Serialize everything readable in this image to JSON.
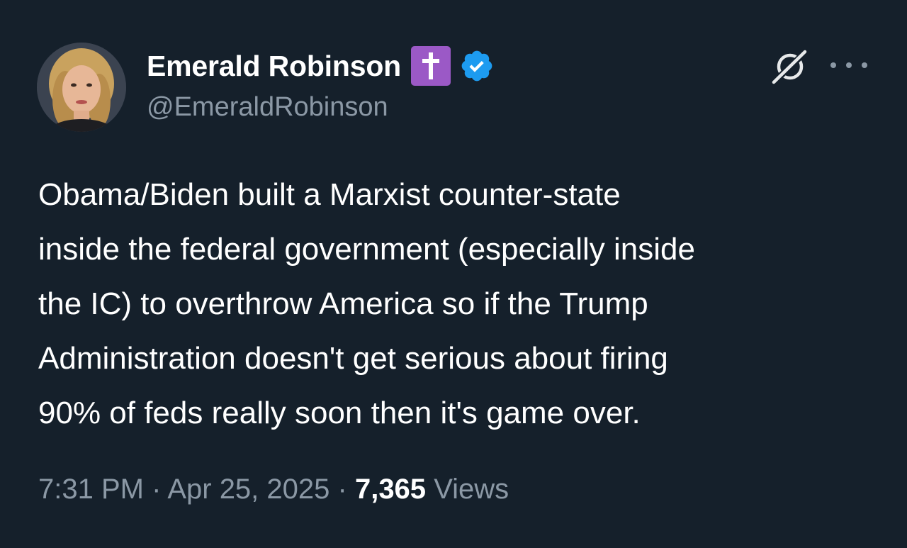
{
  "author": {
    "display_name": "Emerald Robinson",
    "handle": "@EmeraldRobinson",
    "badge_emoji": "latin-cross-icon",
    "verified": true,
    "verified_color": "#1d9bf0",
    "badge_color": "#9b59c6"
  },
  "tweet": {
    "lines": [
      "Obama/Biden built a Marxist counter-state",
      "inside the federal government (especially inside",
      "the IC) to overthrow America so if the Trump",
      "Administration doesn't get serious about firing",
      "90% of feds really soon then it's game over."
    ]
  },
  "meta": {
    "time": "7:31 PM",
    "separator": "·",
    "date": "Apr 25, 2025",
    "views_count": "7,365",
    "views_label": "Views"
  },
  "icons": {
    "grok": "grok-icon",
    "more": "more-options-icon"
  },
  "theme": {
    "background": "#15202b",
    "text": "#ffffff",
    "secondary_text": "#8b98a5"
  }
}
